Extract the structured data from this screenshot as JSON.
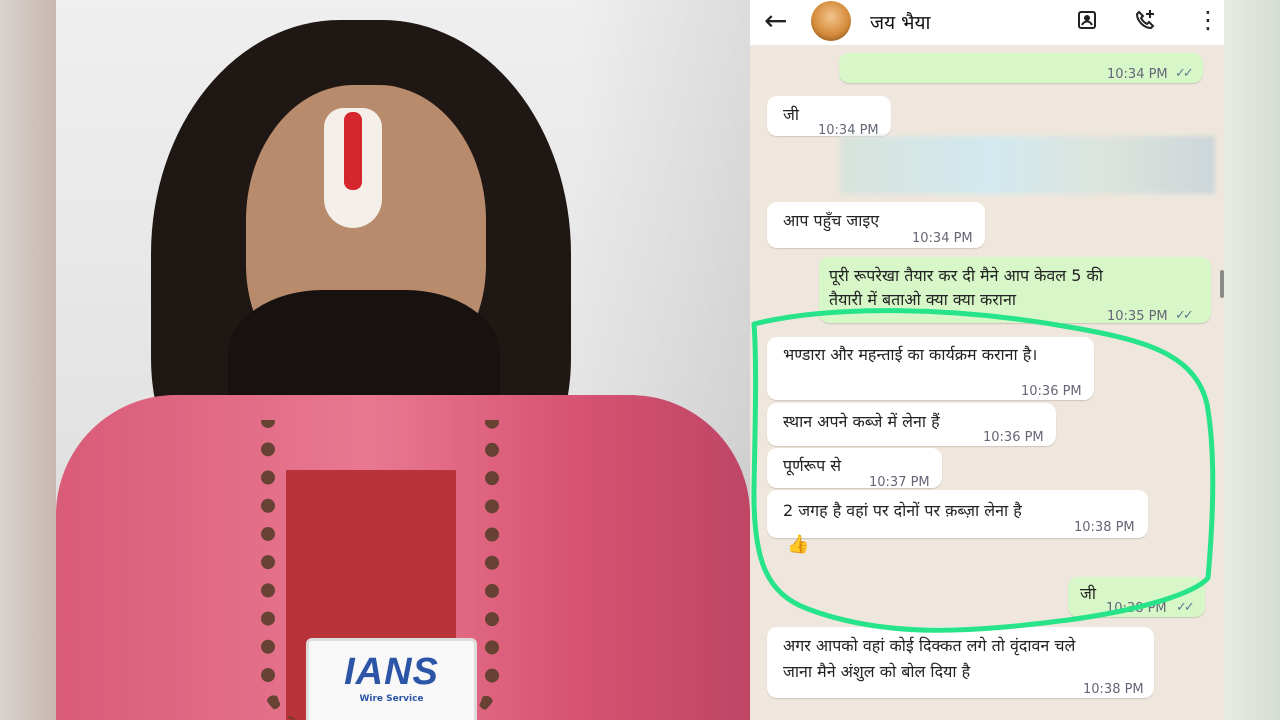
{
  "photo": {
    "mic_logo": "IANS",
    "mic_sub": "Wire Service"
  },
  "chat": {
    "contact_name": "जय भैया",
    "icons": [
      "back-arrow-icon",
      "avatar",
      "contact-card-icon",
      "add-call-icon",
      "more-vert-icon"
    ],
    "messages": [
      {
        "type": "sent",
        "text": "",
        "time": "10:34 PM",
        "ticks": "✓✓"
      },
      {
        "type": "received",
        "text": "जी",
        "time": "10:34 PM"
      },
      {
        "type": "received",
        "text": "आप पहुँच जाइए",
        "time": "10:34 PM"
      },
      {
        "type": "sent",
        "line1": "पूरी रूपरेखा तैयार कर दी मैने आप केवल 5 की",
        "line2": "तैयारी में बताओ क्या क्या कराना",
        "time": "10:35 PM",
        "ticks": "✓✓"
      },
      {
        "type": "received",
        "text": "भण्डारा और महन्ताई का कार्यक्रम कराना है।",
        "time": "10:36 PM"
      },
      {
        "type": "received",
        "text": "स्थान अपने कब्जे में लेना हैं",
        "time": "10:36 PM"
      },
      {
        "type": "received",
        "text": "पूर्णरूप से",
        "time": "10:37 PM"
      },
      {
        "type": "received",
        "text": "2 जगह है वहां पर दोनों पर क़ब्ज़ा लेना है",
        "time": "10:38 PM",
        "reaction": "👍"
      },
      {
        "type": "sent",
        "text": "जी",
        "time": "10:38 PM",
        "ticks": "✓✓"
      },
      {
        "type": "received",
        "line1": "अगर आपको वहां कोई दिक्कत लगे तो वृंदावन चले",
        "line2": "जाना मैने अंशुल को बोल दिया है",
        "time": "10:38 PM"
      }
    ],
    "highlight_color": "#27e38a"
  }
}
